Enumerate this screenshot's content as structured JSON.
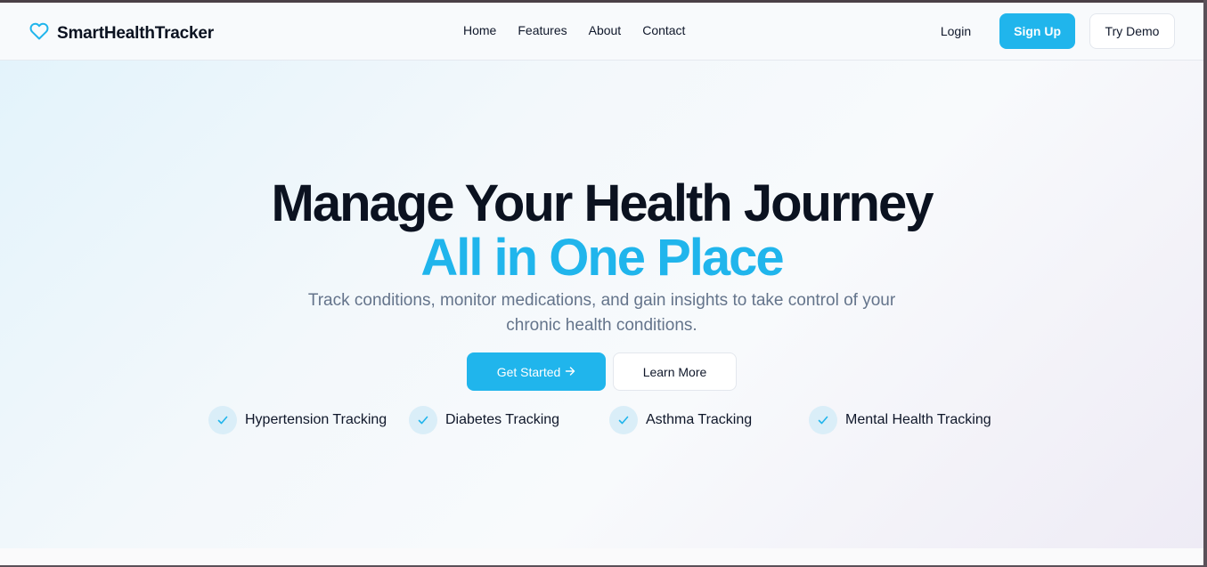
{
  "brand": {
    "name": "SmartHealthTracker",
    "icon": "heart-icon",
    "accent": "#20b5ec"
  },
  "nav": {
    "items": [
      {
        "label": "Home"
      },
      {
        "label": "Features"
      },
      {
        "label": "About"
      },
      {
        "label": "Contact"
      }
    ]
  },
  "auth": {
    "login": "Login",
    "signup": "Sign Up",
    "demo": "Try Demo"
  },
  "hero": {
    "headline": "Manage Your Health Journey",
    "headline_accent": "All in One Place",
    "subtitle": "Track conditions, monitor medications, and gain insights to take control of your chronic health conditions.",
    "primary_cta": "Get Started",
    "primary_cta_icon": "arrow-right-icon",
    "secondary_cta": "Learn More"
  },
  "features": [
    {
      "label": "Hypertension Tracking",
      "icon": "check-icon"
    },
    {
      "label": "Diabetes Tracking",
      "icon": "check-icon"
    },
    {
      "label": "Asthma Tracking",
      "icon": "check-icon"
    },
    {
      "label": "Mental Health Tracking",
      "icon": "check-icon"
    }
  ]
}
